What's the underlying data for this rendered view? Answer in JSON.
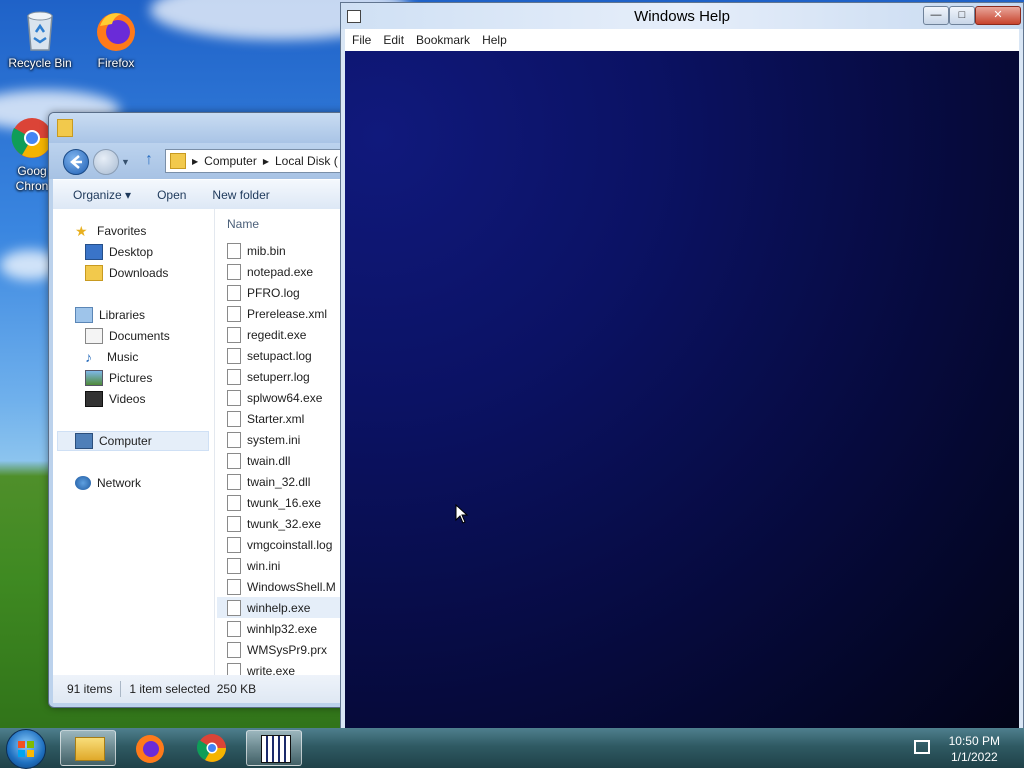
{
  "desktop": {
    "icons": [
      {
        "label": "Recycle Bin",
        "icon": "recycle-bin-icon"
      },
      {
        "label": "Firefox",
        "icon": "firefox-icon"
      },
      {
        "label": "Goog\nChron",
        "icon": "chrome-icon"
      }
    ]
  },
  "explorer": {
    "breadcrumb": [
      "Computer",
      "Local Disk ("
    ],
    "toolbar": {
      "organize": "Organize ▾",
      "open": "Open",
      "new_folder": "New folder"
    },
    "nav": {
      "favorites": "Favorites",
      "desktop": "Desktop",
      "downloads": "Downloads",
      "libraries": "Libraries",
      "documents": "Documents",
      "music": "Music",
      "pictures": "Pictures",
      "videos": "Videos",
      "computer": "Computer",
      "network": "Network"
    },
    "column_header": "Name",
    "files": [
      "mib.bin",
      "notepad.exe",
      "PFRO.log",
      "Prerelease.xml",
      "regedit.exe",
      "setupact.log",
      "setuperr.log",
      "splwow64.exe",
      "Starter.xml",
      "system.ini",
      "twain.dll",
      "twain_32.dll",
      "twunk_16.exe",
      "twunk_32.exe",
      "vmgcoinstall.log",
      "win.ini",
      "WindowsShell.M",
      "winhelp.exe",
      "winhlp32.exe",
      "WMSysPr9.prx",
      "write.exe"
    ],
    "selected_file": "winhelp.exe",
    "status": {
      "count": "91 items",
      "selection": "1 item selected  250 KB"
    }
  },
  "help_window": {
    "title": "Windows Help",
    "menu": [
      "File",
      "Edit",
      "Bookmark",
      "Help"
    ],
    "controls": {
      "minimize": "—",
      "maximize": "□",
      "close": "✕"
    }
  },
  "taskbar": {
    "start": "start-orb",
    "pinned": [
      "explorer-icon",
      "firefox-icon",
      "chrome-icon",
      "winhelp-icon"
    ],
    "clock_time": "10:50 PM",
    "clock_date": "1/1/2022"
  },
  "colors": {
    "help_bg": "#0b1264",
    "selection": "#e5eef9",
    "taskbar": "#2f5a63"
  }
}
